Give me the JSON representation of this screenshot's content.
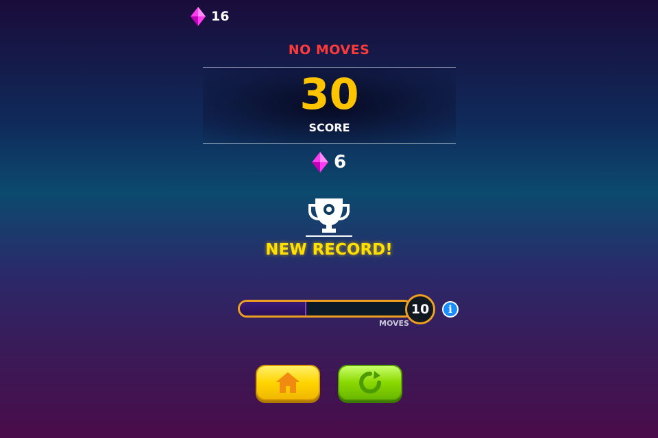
{
  "hud": {
    "gems": "16",
    "gem_icon": "pink-gem-icon"
  },
  "result": {
    "status": "NO MOVES",
    "score": "30",
    "score_label": "SCORE",
    "gems_earned": "6",
    "record_text": "NEW RECORD!"
  },
  "progress": {
    "moves": "10",
    "moves_label": "MOVES",
    "fill_fraction": 0.38
  },
  "buttons": {
    "home_icon": "home-icon",
    "retry_icon": "restart-icon"
  },
  "colors": {
    "accent": "#ffc400",
    "status": "#ff3a3a",
    "gem": "#ff3cf0"
  }
}
